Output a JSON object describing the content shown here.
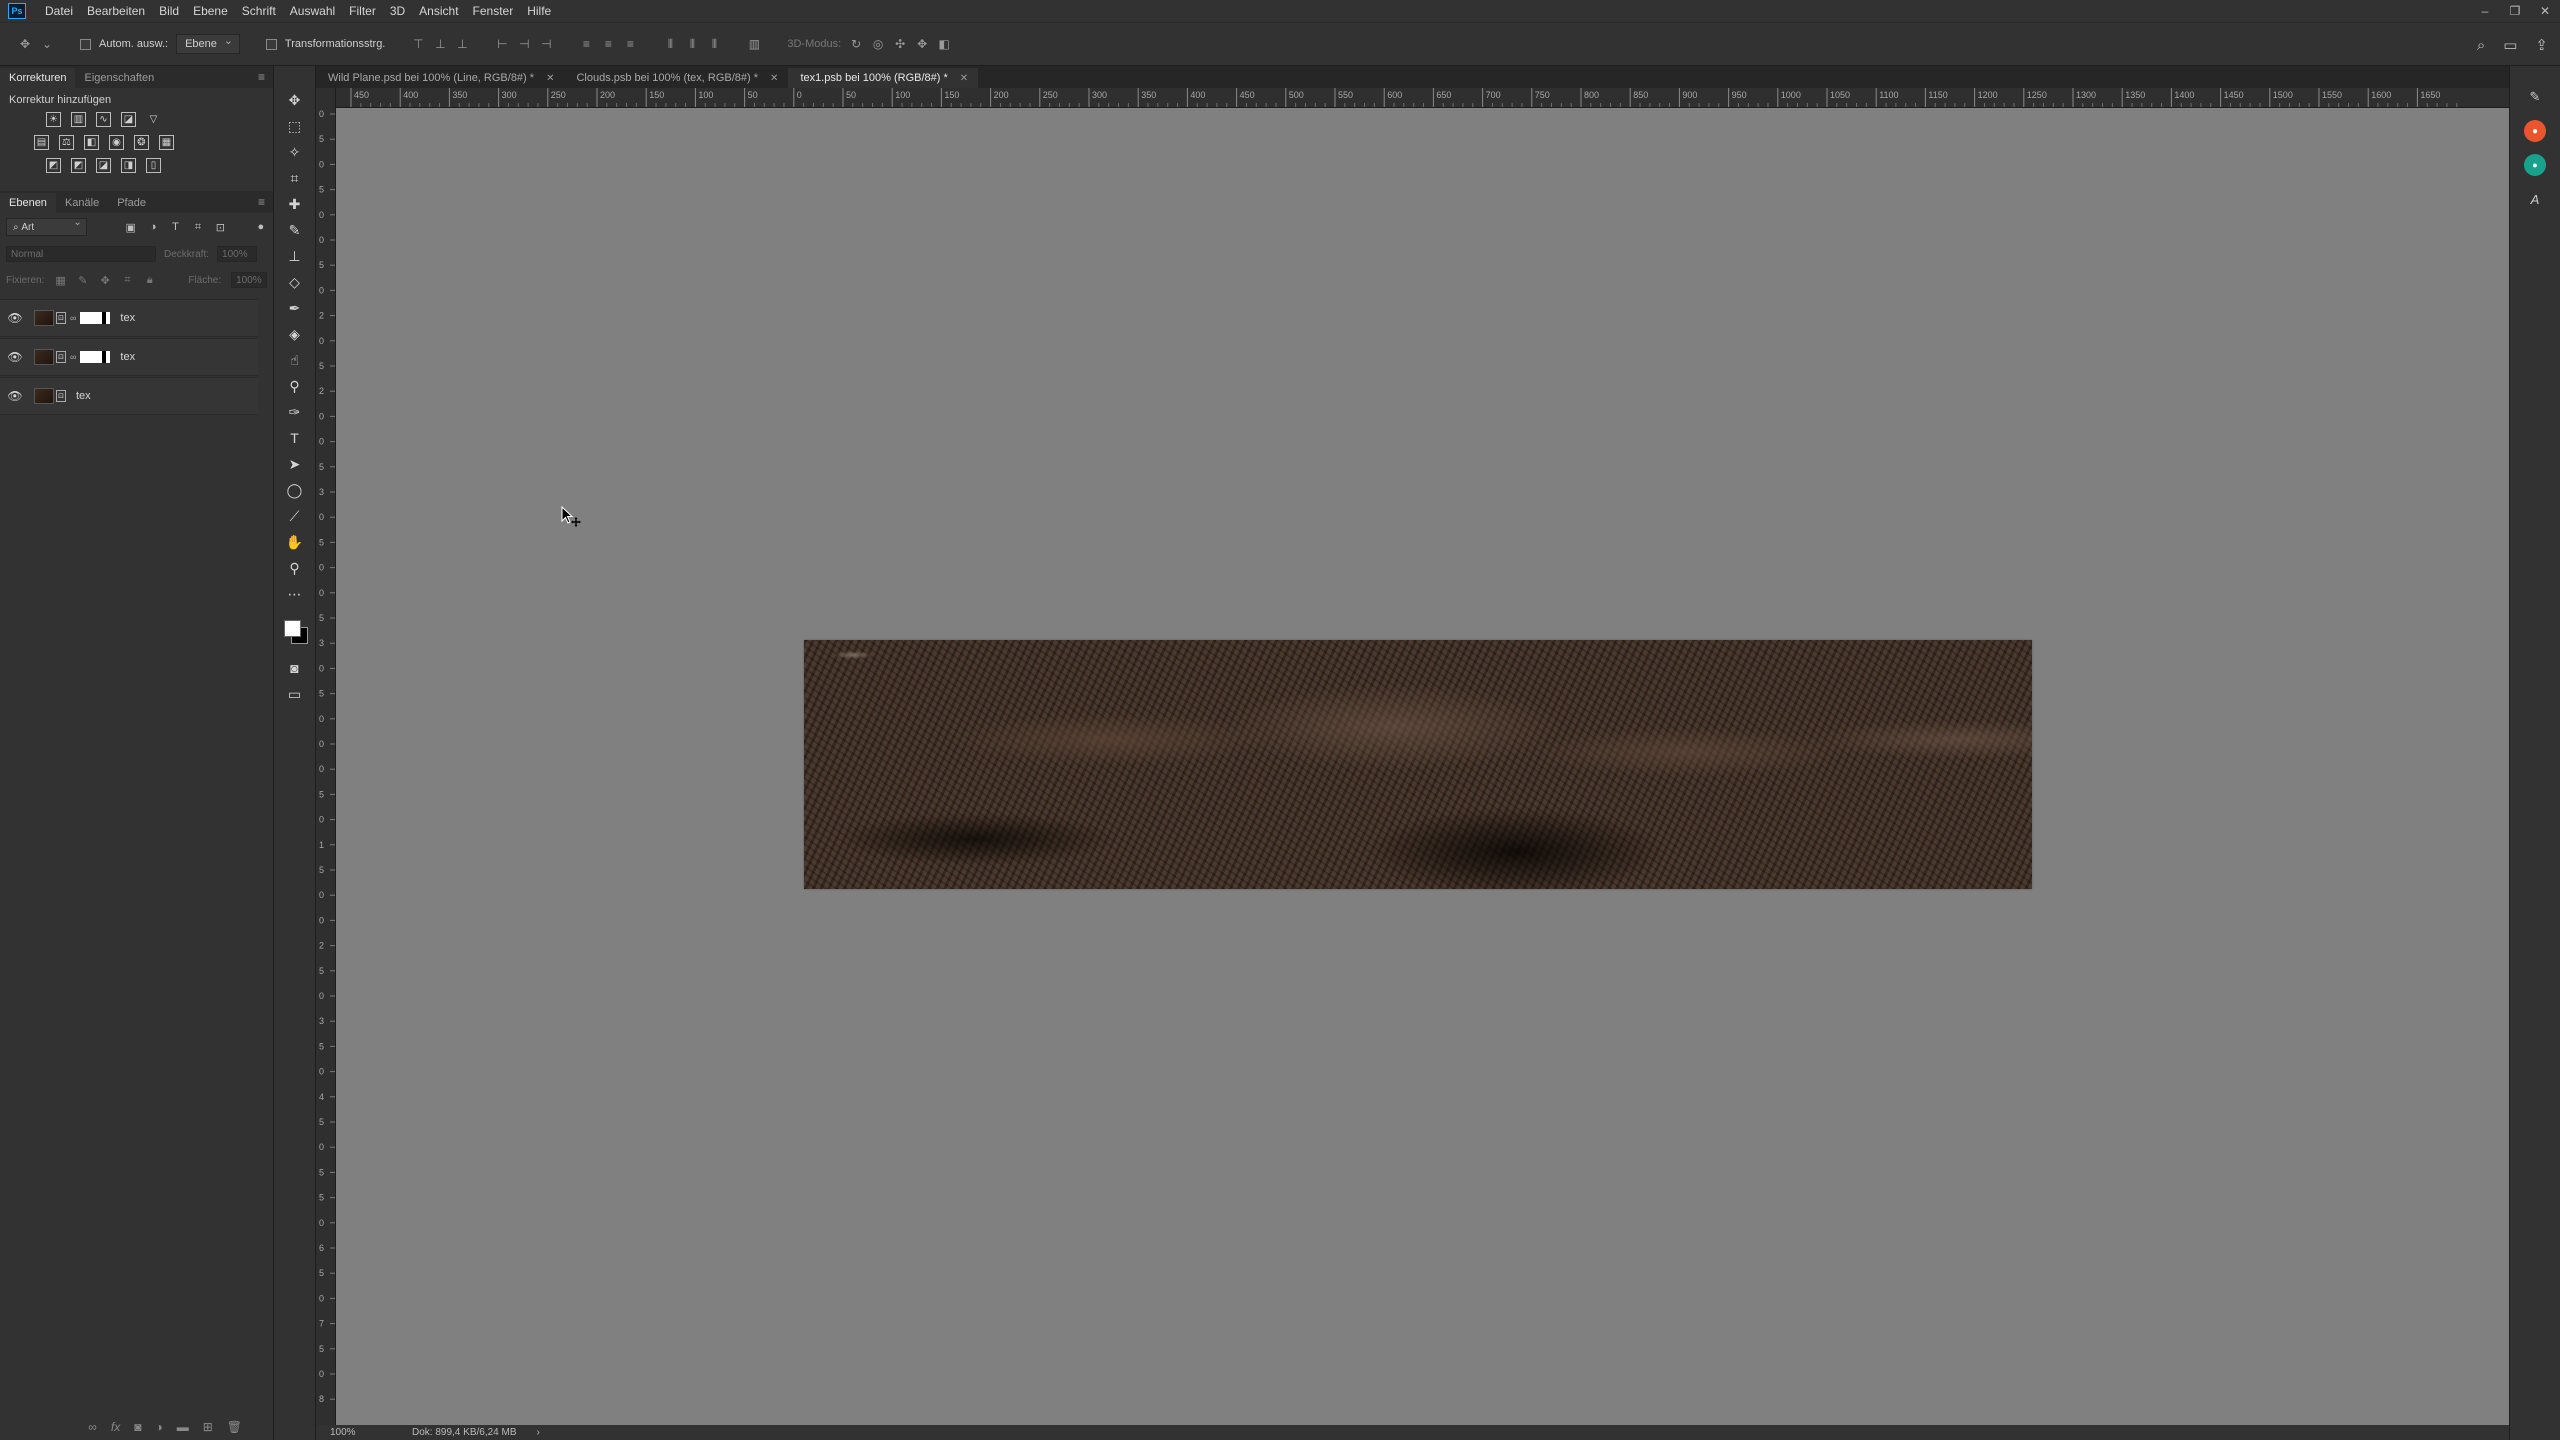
{
  "app": {
    "logo": "Ps"
  },
  "menu": [
    "Datei",
    "Bearbeiten",
    "Bild",
    "Ebene",
    "Schrift",
    "Auswahl",
    "Filter",
    "3D",
    "Ansicht",
    "Fenster",
    "Hilfe"
  ],
  "window_controls": [
    "–",
    "❐",
    "✕"
  ],
  "options": {
    "auto_select_label": "Autom. ausw.:",
    "auto_select_target": "Ebene",
    "transform_label": "Transformationsstrg.",
    "mode_3d_label": "3D-Modus:"
  },
  "left_panels": {
    "top_tabs": [
      "Korrekturen",
      "Eigenschaften"
    ],
    "corrections_title": "Korrektur hinzufügen",
    "layer_tabs": [
      "Ebenen",
      "Kanäle",
      "Pfade"
    ],
    "filter_kind": "Art",
    "blend_mode": "Normal",
    "opacity_label": "Deckkraft:",
    "opacity_value": "100%",
    "lock_label": "Fixieren:",
    "fill_label": "Fläche:",
    "fill_value": "100%",
    "layers": [
      {
        "name": "tex",
        "has_mask": true
      },
      {
        "name": "tex",
        "has_mask": true
      },
      {
        "name": "tex",
        "has_mask": false
      }
    ]
  },
  "doc_tabs": [
    {
      "label": "Wild Plane.psd bei 100% (Line, RGB/8#) *",
      "active": false
    },
    {
      "label": "Clouds.psb bei 100% (tex, RGB/8#) *",
      "active": false
    },
    {
      "label": "tex1.psb bei 100% (RGB/8#) *",
      "active": true
    }
  ],
  "ruler_h_labels": [
    "450",
    "400",
    "350",
    "300",
    "250",
    "200",
    "150",
    "100",
    "50",
    "0",
    "50",
    "100",
    "150",
    "200",
    "250",
    "300",
    "350",
    "400",
    "450",
    "500",
    "550",
    "600",
    "650",
    "700",
    "750",
    "800",
    "850",
    "900",
    "950",
    "1000",
    "1050",
    "1100",
    "1150",
    "1200",
    "1250",
    "1300",
    "1350",
    "1400",
    "1450",
    "1500",
    "1550",
    "1600",
    "1650"
  ],
  "ruler_v_labels": [
    "0",
    "5",
    "0",
    "5",
    "0",
    "0",
    "5",
    "0",
    "2",
    "0",
    "5",
    "2",
    "0",
    "0",
    "5",
    "3",
    "0",
    "5",
    "0",
    "0",
    "5",
    "3",
    "0",
    "5",
    "0",
    "0",
    "0",
    "5",
    "0",
    "1",
    "5",
    "0",
    "0",
    "2",
    "5",
    "0",
    "3",
    "5",
    "0",
    "4",
    "5",
    "0",
    "5",
    "5",
    "0",
    "6",
    "5",
    "0",
    "7",
    "5",
    "0",
    "8"
  ],
  "status": {
    "zoom": "100%",
    "doc": "Dok: 899,4 KB/6,24 MB",
    "arrow": "›"
  },
  "colors": {
    "foreground": "#ffffff",
    "background": "#000000",
    "canvas": "#808080",
    "accent": "#31a8ff"
  }
}
